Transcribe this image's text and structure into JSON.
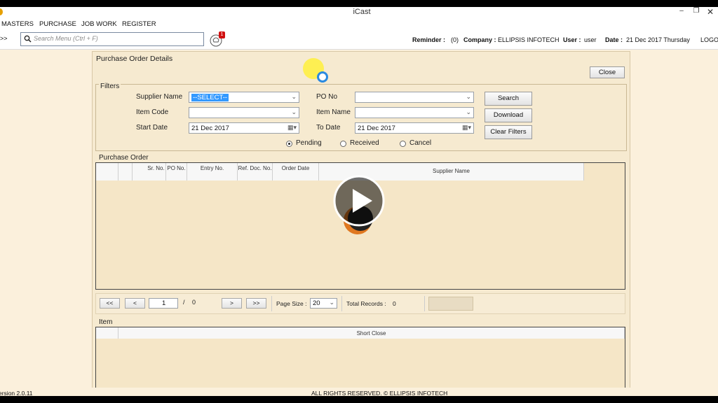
{
  "app": {
    "title": "iCast"
  },
  "menu": [
    "MASTERS",
    "PURCHASE",
    "JOB WORK",
    "REGISTER"
  ],
  "toolbar": {
    "nav_label": ">>",
    "search_placeholder": "Search Menu (Ctrl + F)",
    "notification_count": "1",
    "reminder_label": "Reminder :",
    "reminder_value": "(0)",
    "company_label": "Company :",
    "company_value": "ELLIPSIS INFOTECH",
    "user_label": "User :",
    "user_value": "user",
    "date_label": "Date :",
    "date_value": "21 Dec 2017 Thursday",
    "logout_label": "LOGO"
  },
  "form": {
    "title": "Purchase Order Details",
    "close_label": "Close",
    "filters_label": "Filters",
    "supplier_name_label": "Supplier Name",
    "supplier_name_value": "--SELECT--",
    "po_no_label": "PO No",
    "po_no_value": "",
    "item_code_label": "Item Code",
    "item_code_value": "",
    "item_name_label": "Item Name",
    "item_name_value": "",
    "start_date_label": "Start Date",
    "start_date_value": "21 Dec 2017",
    "to_date_label": "To Date",
    "to_date_value": "21 Dec 2017",
    "search_label": "Search",
    "download_label": "Download",
    "clear_label": "Clear Filters",
    "radio_pending": "Pending",
    "radio_received": "Received",
    "radio_cancel": "Cancel"
  },
  "purchase_order": {
    "label": "Purchase Order",
    "columns": [
      "Sr. No.",
      "PO No.",
      "Entry No.",
      "Ref. Doc. No.",
      "Order Date",
      "Supplier Name"
    ]
  },
  "pager": {
    "first": "<<",
    "prev": "<",
    "page": "1",
    "sep": "/",
    "total_pages": "0",
    "next": ">",
    "last": ">>",
    "page_size_label": "Page Size :",
    "page_size_value": "20",
    "total_records_label": "Total Records :",
    "total_records_value": "0"
  },
  "item": {
    "label": "Item",
    "columns": [
      "Short Close"
    ]
  },
  "status": {
    "version": "ersion  2.0.11",
    "rights": "ALL RIGHTS RESERVED. © ELLIPSIS INFOTECH"
  }
}
